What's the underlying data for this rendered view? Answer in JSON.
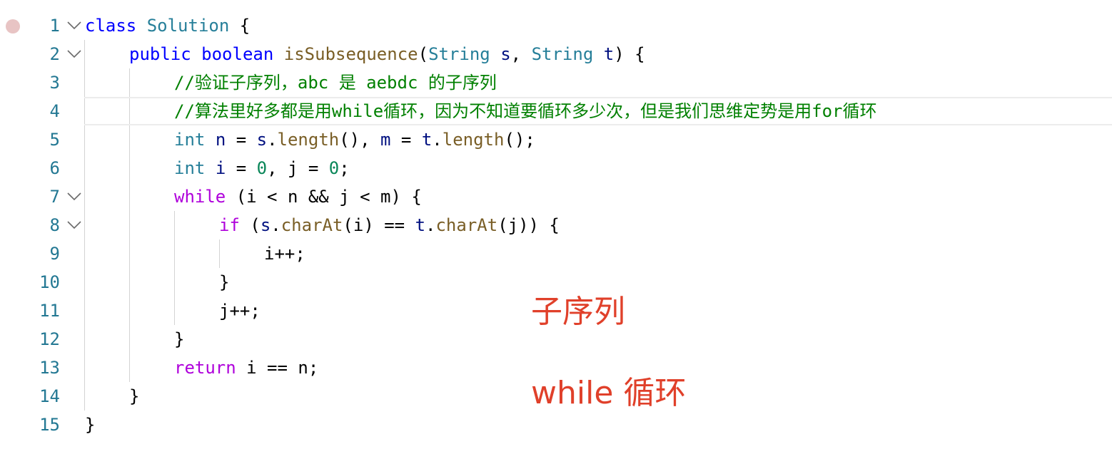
{
  "editor": {
    "line_numbers": [
      "1",
      "2",
      "3",
      "4",
      "5",
      "6",
      "7",
      "8",
      "9",
      "10",
      "11",
      "12",
      "13",
      "14",
      "15"
    ],
    "code": {
      "l1": {
        "kw": "class",
        "cls": "Solution",
        "rest": " {"
      },
      "l2": {
        "kw": "public",
        "type": "boolean",
        "fn": "isSubsequence",
        "p1": "(",
        "t1": "String",
        "v1": "s",
        "c1": ", ",
        "t2": "String",
        "v2": "t",
        "rest": ") {"
      },
      "l3": {
        "comment": "//验证子序列，abc 是 aebdc 的子序列"
      },
      "l4": {
        "comment": "//算法里好多都是用while循环，因为不知道要循环多少次，但是我们思维定势是用for循环"
      },
      "l5": {
        "type": "int",
        "v1": "n",
        "eq1": " = ",
        "v2": "s",
        "dot1": ".",
        "fn1": "length",
        "mid": "(), ",
        "v3": "m",
        "eq2": " = ",
        "v4": "t",
        "dot2": ".",
        "fn2": "length",
        "rest": "();"
      },
      "l6": {
        "type": "int",
        "v1": "i",
        "eq1": " = ",
        "n1": "0",
        "mid": ", j = ",
        "n2": "0",
        "rest": ";"
      },
      "l7": {
        "kw": "while",
        "rest": " (i < n && j < m) {"
      },
      "l8": {
        "kw": "if",
        "p1": " (",
        "v1": "s",
        "dot1": ".",
        "fn1": "charAt",
        "mid": "(i) == ",
        "v2": "t",
        "dot2": ".",
        "fn2": "charAt",
        "rest": "(j)) {"
      },
      "l9": {
        "text": "i++;"
      },
      "l10": {
        "text": "}"
      },
      "l11": {
        "text": "j++;"
      },
      "l12": {
        "text": "}"
      },
      "l13": {
        "kw": "return",
        "rest": " i == n;"
      },
      "l14": {
        "text": "}"
      },
      "l15": {
        "text": "}"
      }
    }
  },
  "annotations": {
    "subsequence": "子序列",
    "while_loop": "while 循环"
  },
  "colors": {
    "keyword": "#0000ff",
    "control": "#af00db",
    "class": "#267f99",
    "function": "#795e26",
    "variable": "#001080",
    "number": "#098658",
    "comment": "#008000",
    "line_number": "#237893",
    "annotation": "#e0402a",
    "breakpoint": "#e8c4c4"
  },
  "icons": {
    "breakpoint": "breakpoint-dot-icon",
    "fold": "chevron-down-icon"
  }
}
